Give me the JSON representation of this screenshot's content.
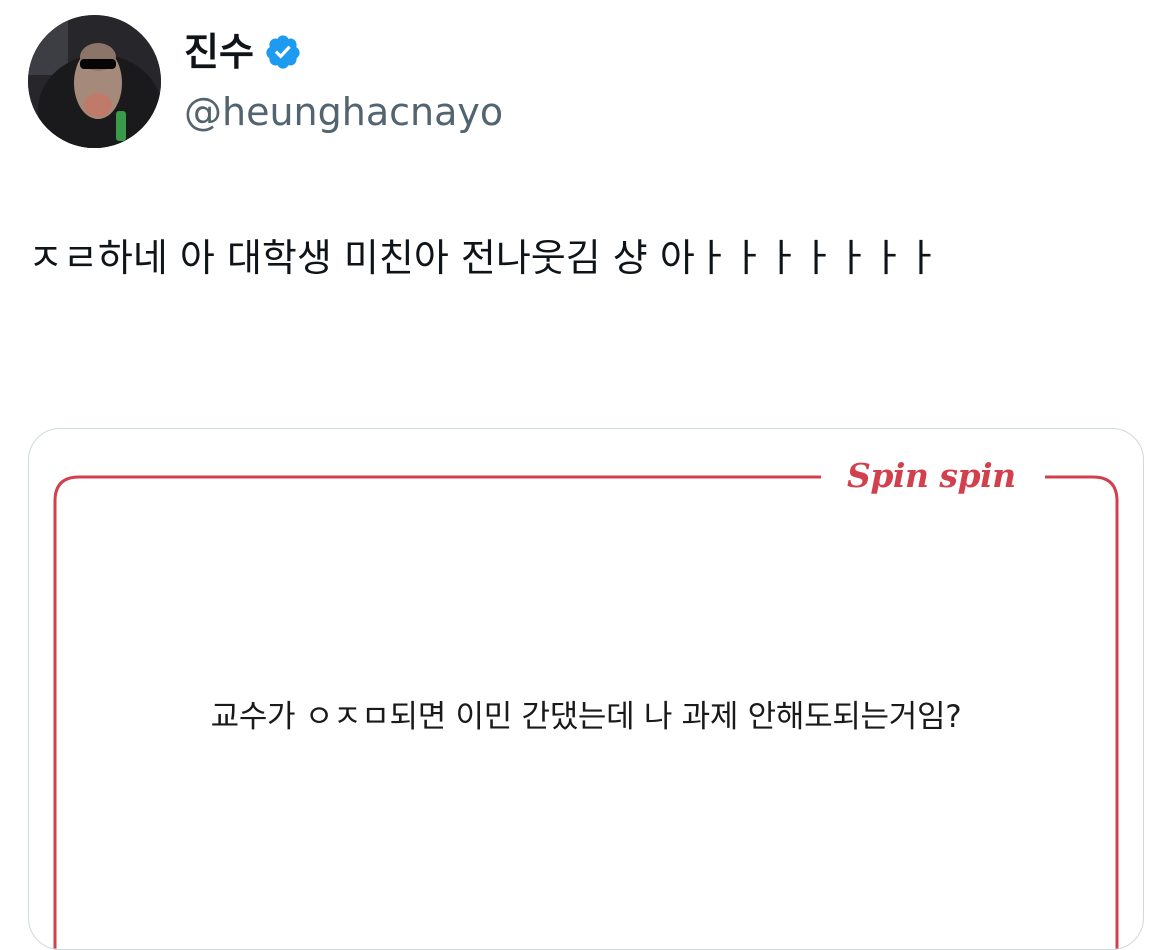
{
  "author": {
    "display_name": "진수",
    "handle": "@heunghacnayo",
    "verified_icon": "verified-badge-icon",
    "avatar_icon": "avatar-image",
    "verified_color": "#1d9bf0"
  },
  "tweet": {
    "text": "ㅈㄹ하네 아 대학생 미친아 전나웃김 샹 아ㅏㅏㅏㅏㅏㅏㅏ"
  },
  "card": {
    "brand": "Spin spin",
    "question": "교수가 ㅇㅈㅁ되면 이민 간댔는데 나 과제 안해도되는거임?",
    "frame_color": "#d2404e"
  }
}
